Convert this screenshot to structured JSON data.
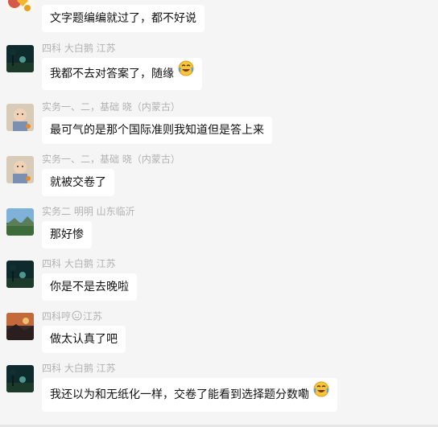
{
  "messages": [
    {
      "sender": "",
      "text": "文字题编编就过了，都不好说",
      "avatar": "gold-avatar",
      "emoji": false
    },
    {
      "sender": "四科 大白鹅 江苏",
      "text": "我都不去对答案了，随缘",
      "avatar": "night-avatar",
      "emoji": true
    },
    {
      "sender": "实务一、二，基础   晓（内蒙古）",
      "text": "最可气的是那个国际准则我知道但是答上来",
      "avatar": "baby-avatar",
      "emoji": false
    },
    {
      "sender": "实务一、二，基础   晓（内蒙古）",
      "text": "就被交卷了",
      "avatar": "baby-avatar",
      "emoji": false
    },
    {
      "sender": "实务二  明明   山东临沂",
      "text": "那好惨",
      "avatar": "landscape-avatar",
      "emoji": false
    },
    {
      "sender": "四科 大白鹅 江苏",
      "text": "你是不是去晚啦",
      "avatar": "night-avatar",
      "emoji": false
    },
    {
      "sender_parts": [
        "四科哼",
        "江苏"
      ],
      "text": "做太认真了吧",
      "avatar": "sunset-avatar",
      "emoji": false
    },
    {
      "sender": "四科 大白鹅 江苏",
      "text": "我还以为和无纸化一样，交卷了能看到选择题分数嘞",
      "avatar": "night-avatar",
      "emoji": true
    }
  ],
  "icons": {
    "laugh_emoji": "laughing-crying-emoji",
    "badge": "round-face-badge"
  },
  "colors": {
    "background": "#f5f5f5",
    "bubble": "#ffffff",
    "sender": "#b2b2b2",
    "text": "#111111"
  }
}
